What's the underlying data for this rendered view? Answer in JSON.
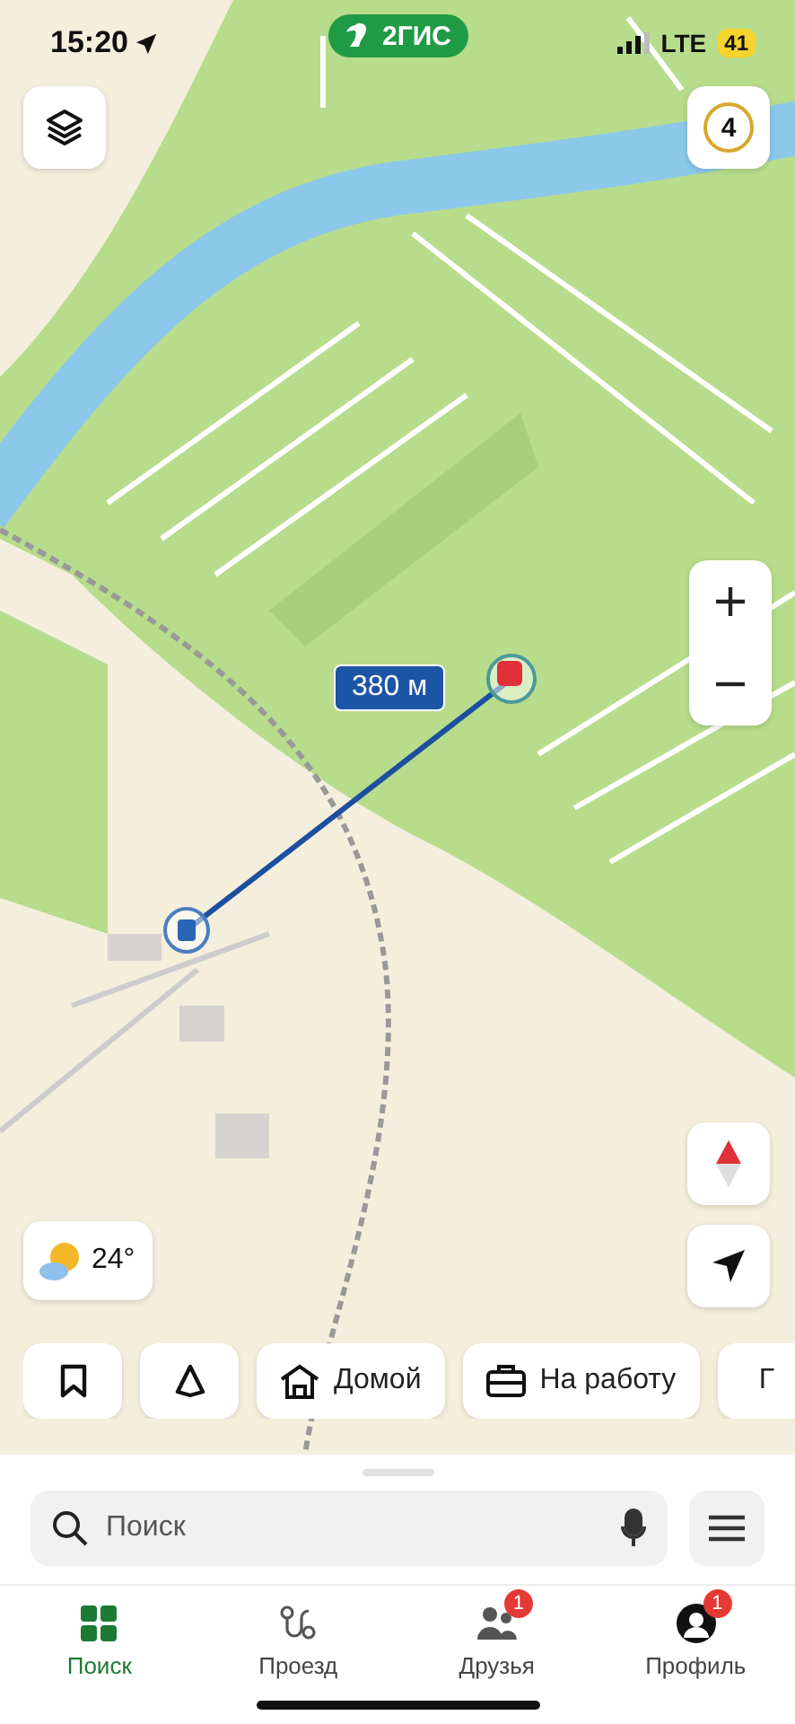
{
  "status_bar": {
    "time": "15:20",
    "network": "LTE",
    "battery": "41"
  },
  "app_badge": "2ГИС",
  "map": {
    "distance_label": "380 м",
    "zoom_level": "4"
  },
  "weather": {
    "temperature": "24°"
  },
  "shortcuts": [
    "Домой",
    "На работу",
    "Г"
  ],
  "search": {
    "placeholder": "Поиск"
  },
  "tabs": [
    {
      "label": "Поиск",
      "selected": true
    },
    {
      "label": "Проезд",
      "selected": false
    },
    {
      "label": "Друзья",
      "selected": false,
      "badge": "1"
    },
    {
      "label": "Профиль",
      "selected": false,
      "badge": "1"
    }
  ]
}
